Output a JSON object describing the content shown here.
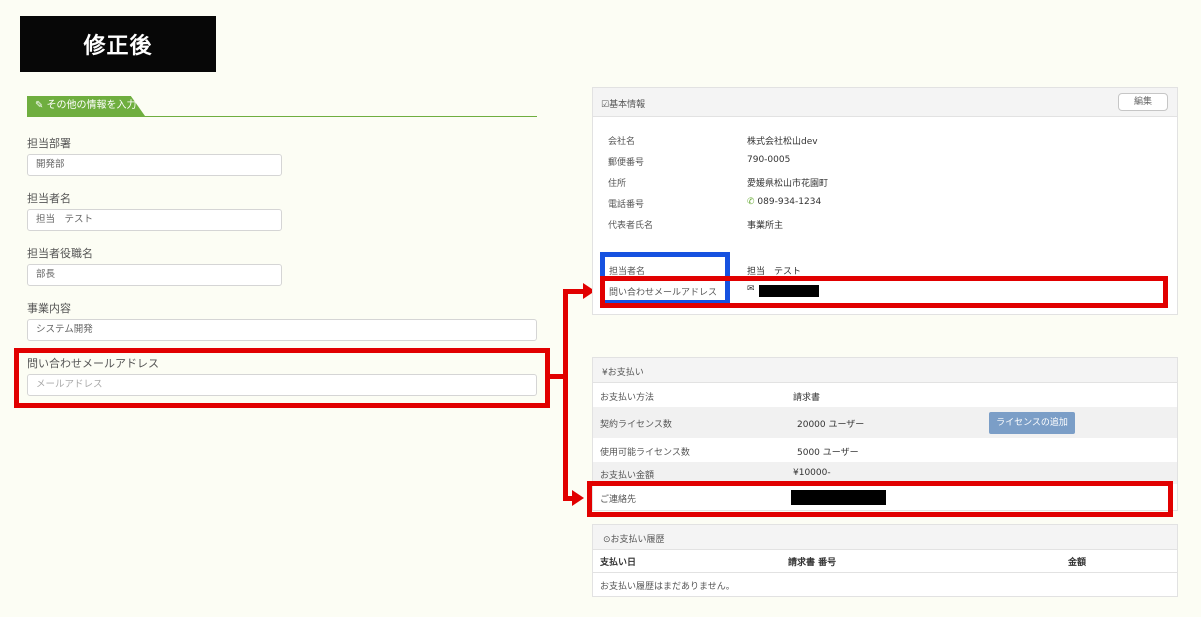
{
  "banner": {
    "title": "修正後"
  },
  "form": {
    "section_tab": "✎ その他の情報を入力",
    "fields": [
      {
        "label": "担当部署",
        "value": "開発部"
      },
      {
        "label": "担当者名",
        "value": "担当　テスト"
      },
      {
        "label": "担当者役職名",
        "value": "部長"
      },
      {
        "label": "事業内容",
        "value": "システム開発"
      }
    ],
    "email_label": "問い合わせメールアドレス",
    "email_placeholder": "メールアドレス"
  },
  "basic_info": {
    "title": "☑基本情報",
    "edit_label": "編集",
    "rows": [
      {
        "label": "会社名",
        "value": "株式会社松山dev"
      },
      {
        "label": "郵便番号",
        "value": "790-0005"
      },
      {
        "label": "住所",
        "value": "愛媛県松山市花園町"
      },
      {
        "label": "電話番号",
        "value": "089-934-1234"
      },
      {
        "label": "代表者氏名",
        "value": "事業所主"
      }
    ],
    "contact_name_label": "担当者名",
    "contact_name_value": "担当　テスト",
    "email_label": "問い合わせメールアドレス"
  },
  "payment": {
    "title": "¥お支払い",
    "rows": [
      {
        "label": "お支払い方法",
        "value": "請求書"
      },
      {
        "label": "契約ライセンス数",
        "value": "20000 ユーザー"
      },
      {
        "label": "使用可能ライセンス数",
        "value": "5000 ユーザー"
      },
      {
        "label": "お支払い金額",
        "value": "¥10000-"
      },
      {
        "label": "ご連絡先",
        "value": ""
      }
    ],
    "add_license_label": "ライセンスの追加"
  },
  "history": {
    "title": "⊙お支払い履歴",
    "columns": [
      "支払い日",
      "請求書 番号",
      "金額"
    ],
    "empty_text": "お支払い履歴はまだありません。"
  },
  "colors": {
    "red": "#e10000",
    "blue": "#1652e0",
    "green": "#6fae3f"
  }
}
